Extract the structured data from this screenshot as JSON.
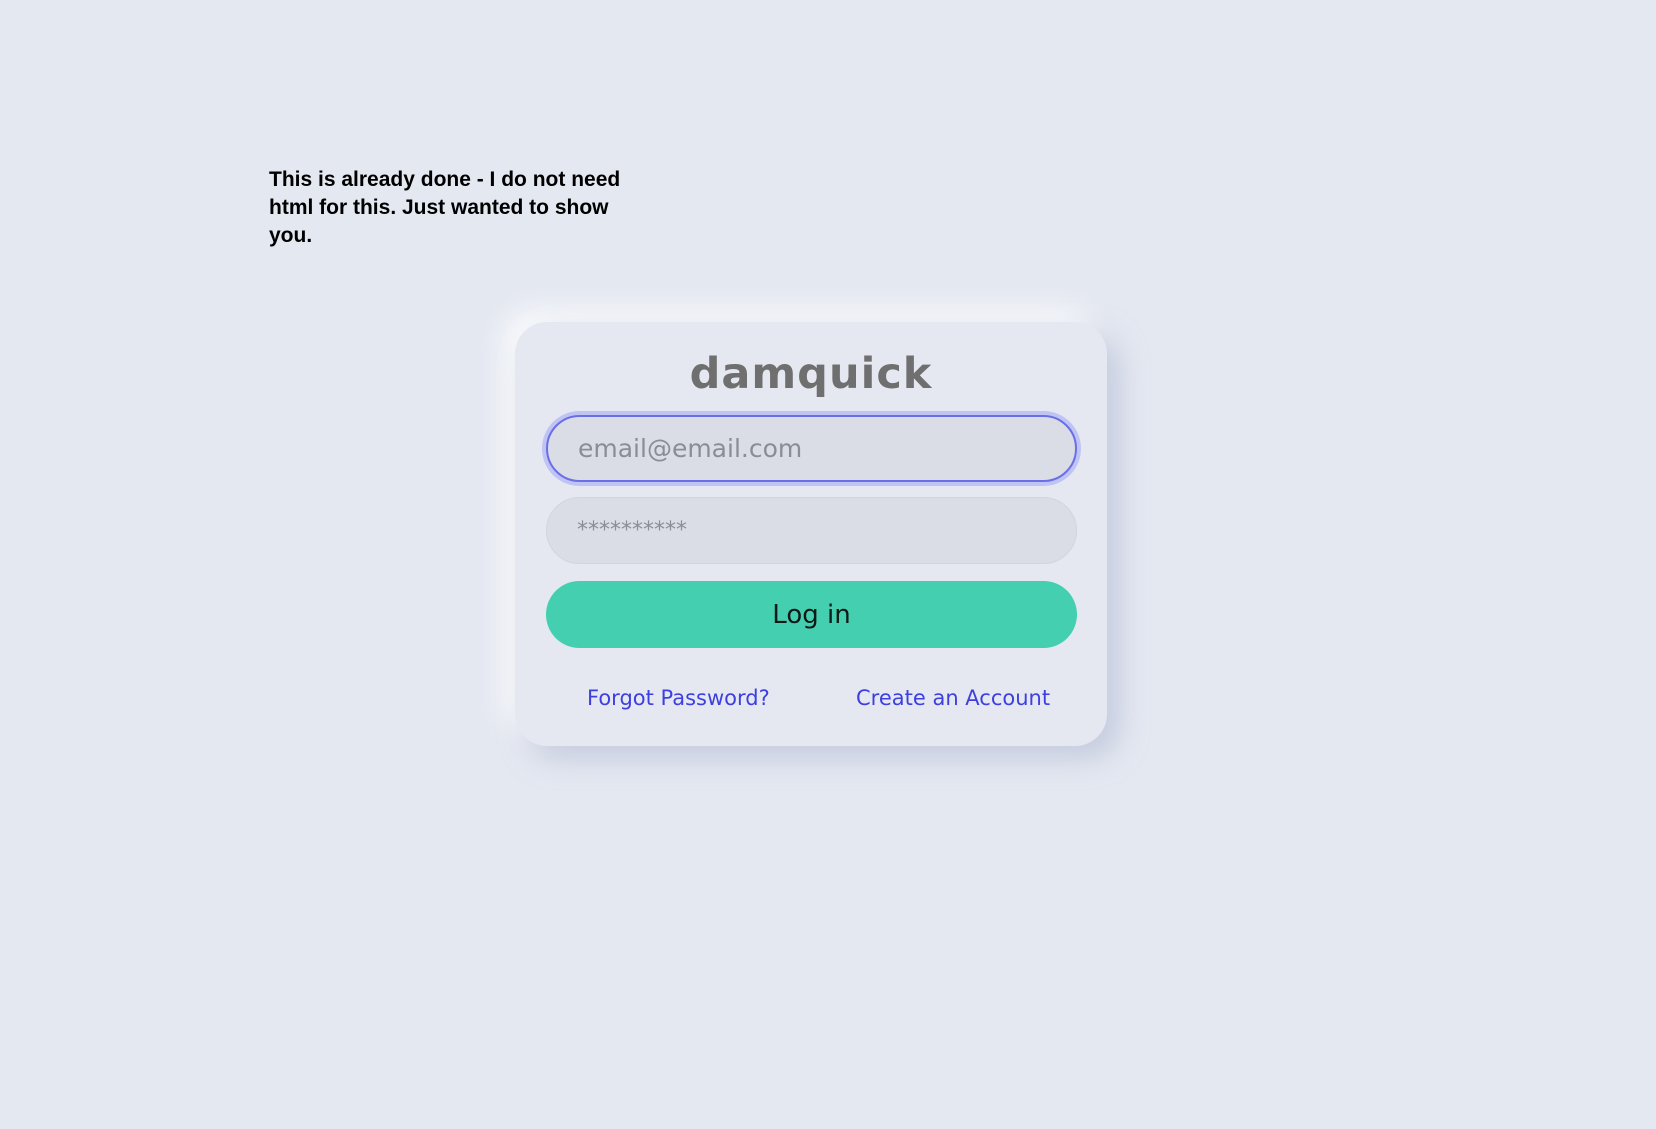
{
  "note": {
    "text": "This is already done - I do not need html for this. Just wanted to show you."
  },
  "login_card": {
    "logo_text": "damquick",
    "email": {
      "placeholder": "email@email.com",
      "value": ""
    },
    "password": {
      "placeholder": "**********",
      "value": ""
    },
    "login_button_label": "Log in",
    "forgot_password_label": "Forgot Password?",
    "create_account_label": "Create an Account"
  },
  "colors": {
    "background": "#e4e8f1",
    "accent_button": "#43cfb0",
    "link": "#3d3fe0",
    "focus_ring": "#6b6fe6"
  }
}
